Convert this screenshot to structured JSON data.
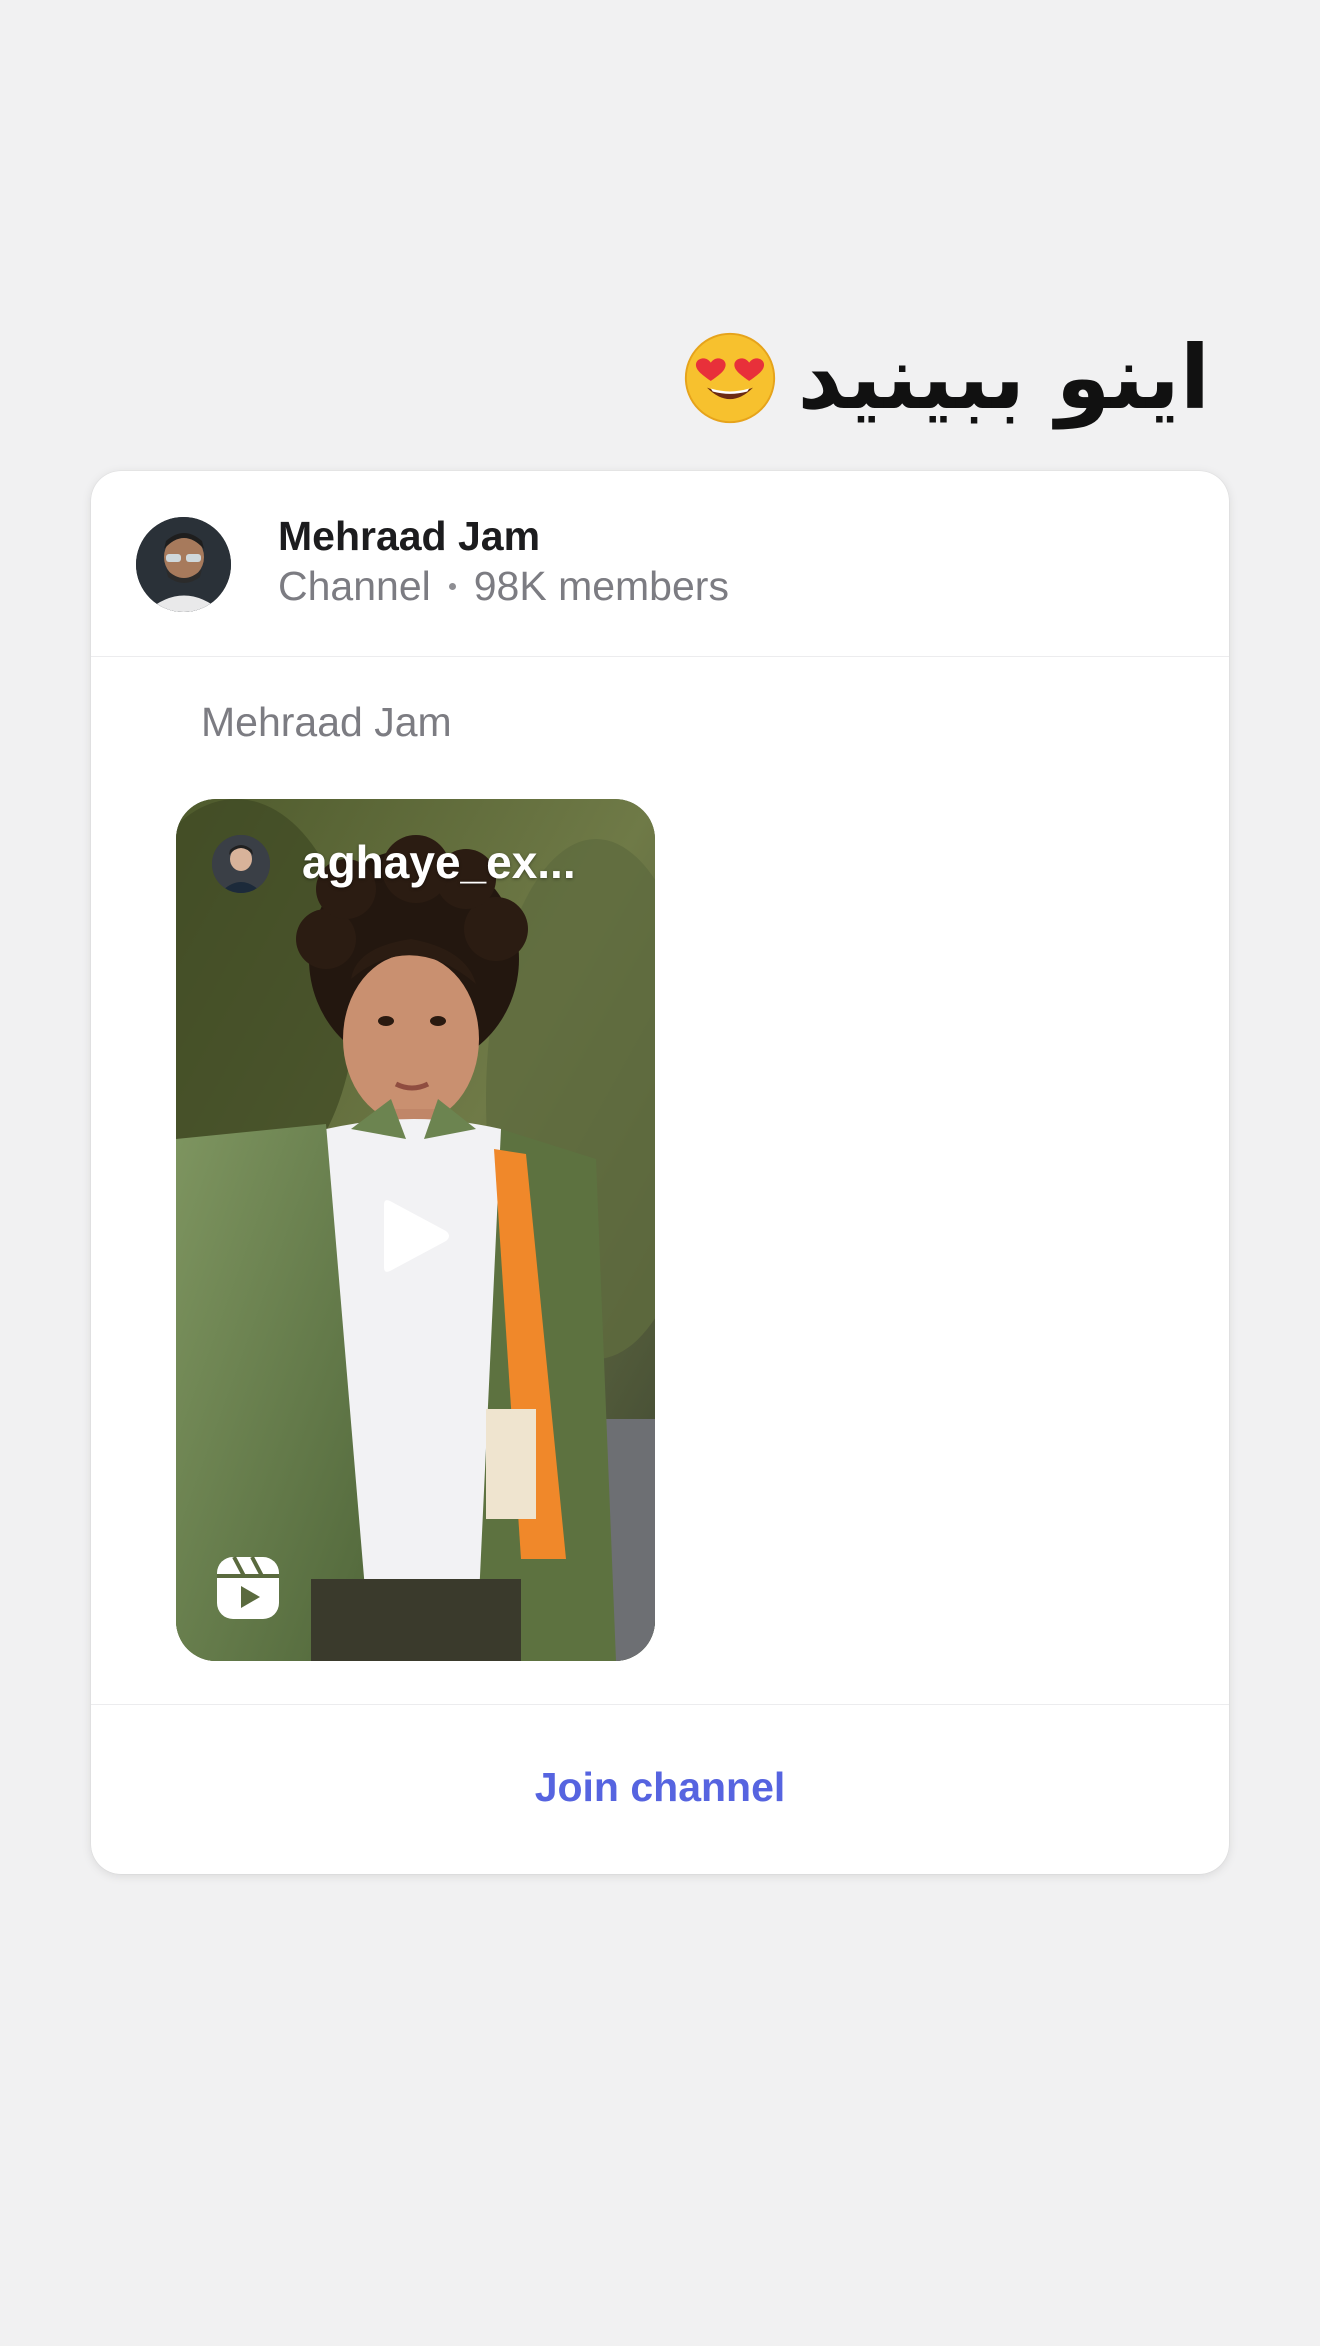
{
  "message": {
    "caption": "اینو ببینید",
    "emoji": "heart-eyes-emoji"
  },
  "channel_card": {
    "name": "Mehraad Jam",
    "type_label": "Channel",
    "members": "98K members",
    "post_author": "Mehraad Jam",
    "reel": {
      "username": "aghaye_ex...",
      "play_icon": "play-icon",
      "reels_icon": "instagram-reels-icon"
    },
    "join_label": "Join channel"
  },
  "colors": {
    "background": "#f1f1f2",
    "card": "#ffffff",
    "accent": "#5664e0",
    "secondary_text": "#7c7c82"
  }
}
